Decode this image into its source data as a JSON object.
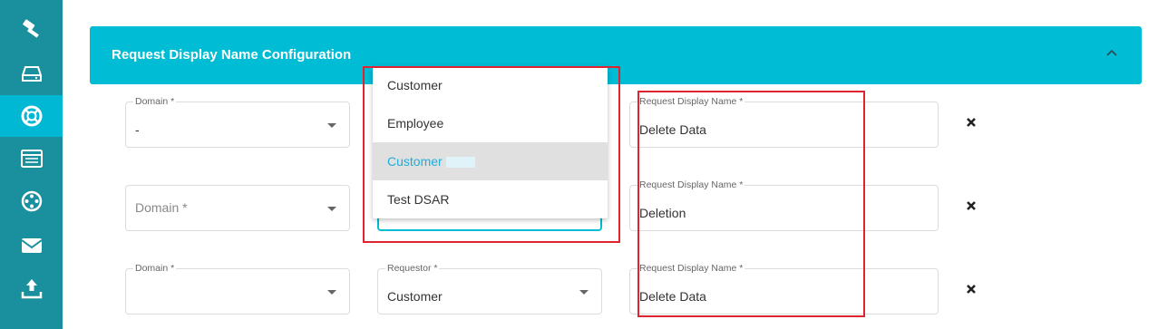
{
  "sidebar": {
    "icons": [
      "gavel-icon",
      "drive-icon",
      "lifebuoy-icon",
      "list-icon",
      "film-reel-icon",
      "mail-icon",
      "upload-icon"
    ],
    "active_index": 2,
    "bg_color": "#1a8f9e",
    "active_color": "#00b8d4"
  },
  "header": {
    "title": "Request Display Name Configuration",
    "bg_color": "#00bcd4"
  },
  "rows": [
    {
      "domain_label": "Domain *",
      "domain_value": "-",
      "display_name_label": "Request Display Name *",
      "display_name_value": "Delete Data"
    },
    {
      "domain_placeholder": "Domain *",
      "display_name_label": "Request Display Name *",
      "display_name_value": "Deletion"
    },
    {
      "domain_label": "Domain *",
      "requestor_label": "Requestor *",
      "requestor_value": "Customer",
      "display_name_label": "Request Display Name *",
      "display_name_value": "Delete Data"
    }
  ],
  "dropdown": {
    "options": [
      "Customer",
      "Employee",
      "Customer",
      "Test DSAR"
    ],
    "selected_index": 2
  }
}
